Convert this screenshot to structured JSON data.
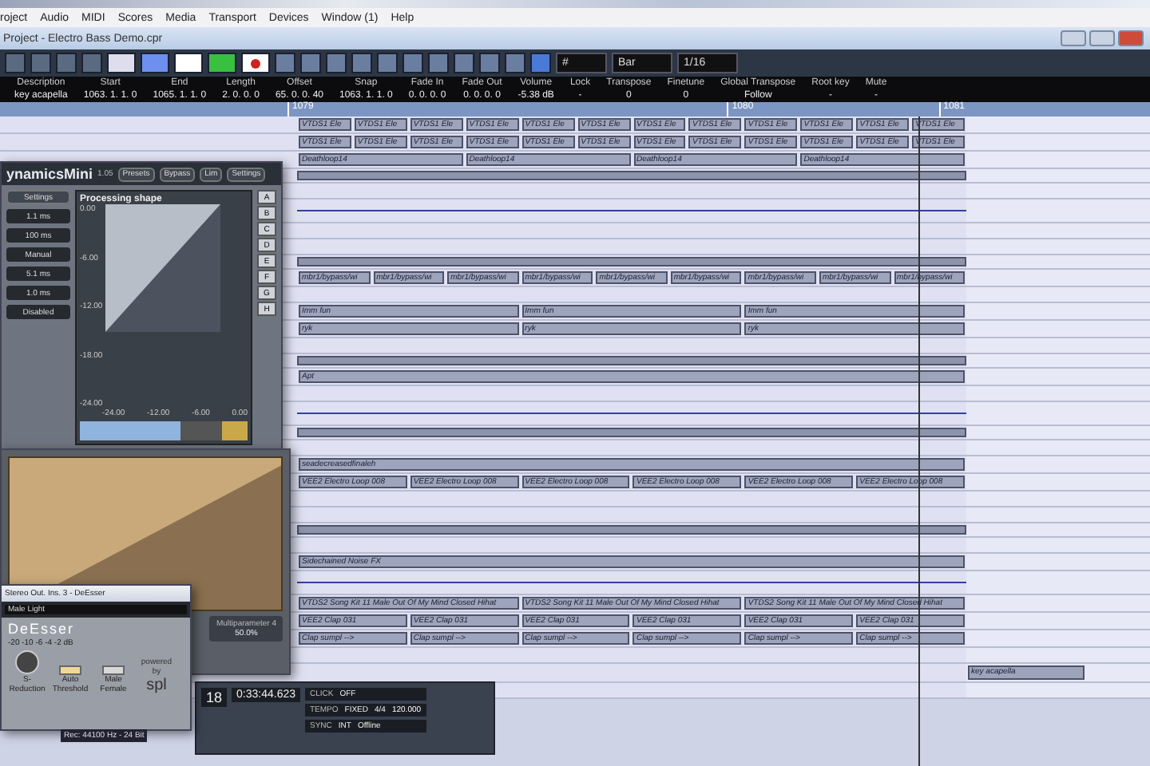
{
  "menu": [
    "roject",
    "Audio",
    "MIDI",
    "Scores",
    "Media",
    "Transport",
    "Devices",
    "Window (1)",
    "Help"
  ],
  "window": {
    "title": "Project - Electro Bass Demo.cpr"
  },
  "toolbar": {
    "quantize": "1/16",
    "grid": "Bar",
    "grid_type": "#",
    "snap_on": true
  },
  "info_line": [
    {
      "label": "Description",
      "value": "key acapella"
    },
    {
      "label": "Start",
      "value": "1063. 1. 1. 0"
    },
    {
      "label": "End",
      "value": "1065. 1. 1. 0"
    },
    {
      "label": "Length",
      "value": "2. 0. 0. 0"
    },
    {
      "label": "Offset",
      "value": "65. 0. 0. 40"
    },
    {
      "label": "Snap",
      "value": "1063. 1. 1. 0"
    },
    {
      "label": "Fade In",
      "value": "0. 0. 0. 0"
    },
    {
      "label": "Fade Out",
      "value": "0. 0. 0. 0"
    },
    {
      "label": "Volume",
      "value": "-5.38 dB"
    },
    {
      "label": "Lock",
      "value": "-"
    },
    {
      "label": "Transpose",
      "value": "0"
    },
    {
      "label": "Finetune",
      "value": "0"
    },
    {
      "label": "Global Transpose",
      "value": "Follow"
    },
    {
      "label": "Root key",
      "value": "-"
    },
    {
      "label": "Mute",
      "value": "-"
    }
  ],
  "ruler": [
    "1079",
    "1080",
    "1081"
  ],
  "lanes": [
    {
      "kind": "events",
      "events": [
        "VTDS1 Ele",
        "VTDS1 Ele",
        "VTDS1 Ele",
        "VTDS1 Ele",
        "VTDS1 Ele",
        "VTDS1 Ele",
        "VTDS1 Ele",
        "VTDS1 Ele",
        "VTDS1 Ele",
        "VTDS1 Ele",
        "VTDS1 Ele",
        "VTDS1 Ele"
      ]
    },
    {
      "kind": "events",
      "events": [
        "VTDS1 Ele",
        "VTDS1 Ele",
        "VTDS1 Ele",
        "VTDS1 Ele",
        "VTDS1 Ele",
        "VTDS1 Ele",
        "VTDS1 Ele",
        "VTDS1 Ele",
        "VTDS1 Ele",
        "VTDS1 Ele",
        "VTDS1 Ele",
        "VTDS1 Ele"
      ]
    },
    {
      "kind": "events",
      "events": [
        "Deathloop14",
        "Deathloop14",
        "Deathloop14",
        "Deathloop14"
      ]
    },
    {
      "kind": "bar"
    },
    {
      "kind": "blank"
    },
    {
      "kind": "automation"
    },
    {
      "kind": "blank"
    },
    {
      "kind": "blank"
    },
    {
      "kind": "bar"
    },
    {
      "kind": "events",
      "events": [
        "mbr1/bypass/wi",
        "mbr1/bypass/wi",
        "mbr1/bypass/wi",
        "mbr1/bypass/wi",
        "mbr1/bypass/wi",
        "mbr1/bypass/wi",
        "mbr1/bypass/wi",
        "mbr1/bypass/wi",
        "mbr1/bypass/wi"
      ]
    },
    {
      "kind": "blank"
    },
    {
      "kind": "events",
      "events": [
        "Imm fun",
        "Imm fun",
        "Imm fun"
      ]
    },
    {
      "kind": "events",
      "events": [
        "ryk",
        "ryk",
        "ryk"
      ]
    },
    {
      "kind": "blank"
    },
    {
      "kind": "bar"
    },
    {
      "kind": "events",
      "events": [
        "Apt"
      ]
    },
    {
      "kind": "blank"
    },
    {
      "kind": "automation"
    },
    {
      "kind": "bar"
    },
    {
      "kind": "blank"
    },
    {
      "kind": "events",
      "events": [
        "seadecreasedfinaleh"
      ]
    },
    {
      "kind": "events",
      "events": [
        "VEE2 Electro Loop 008",
        "VEE2 Electro Loop 008",
        "VEE2 Electro Loop 008",
        "VEE2 Electro Loop 008",
        "VEE2 Electro Loop 008",
        "VEE2 Electro Loop 008"
      ]
    },
    {
      "kind": "blank"
    },
    {
      "kind": "blank"
    },
    {
      "kind": "bar"
    },
    {
      "kind": "blank"
    },
    {
      "kind": "events",
      "events": [
        "Sidechained Noise FX"
      ]
    },
    {
      "kind": "automation"
    },
    {
      "kind": "events",
      "events": [
        "VTDS2 Song Kit 11 Male Out Of My Mind Closed Hihat",
        "VTDS2 Song Kit 11 Male Out Of My Mind Closed Hihat",
        "VTDS2 Song Kit 11 Male Out Of My Mind Closed Hihat"
      ]
    },
    {
      "kind": "events",
      "events": [
        "VEE2 Clap 031",
        "VEE2 Clap 031",
        "VEE2 Clap 031",
        "VEE2 Clap 031",
        "VEE2 Clap 031",
        "VEE2 Clap 031"
      ]
    },
    {
      "kind": "events",
      "events": [
        "Clap sumpl -->",
        "Clap sumpl -->",
        "Clap sumpl -->",
        "Clap sumpl -->",
        "Clap sumpl -->",
        "Clap sumpl -->"
      ]
    },
    {
      "kind": "blank"
    },
    {
      "kind": "tail",
      "events": [
        "key acapella"
      ]
    },
    {
      "kind": "blank"
    }
  ],
  "dynamics": {
    "title": "ynamicsMini",
    "version": "1.05",
    "buttons": [
      "Presets",
      "Bypass",
      "Lim",
      "Settings"
    ],
    "settings_label": "Settings",
    "params": [
      "1.1 ms",
      "100 ms",
      "Manual",
      "5.1 ms",
      "1.0 ms",
      "Disabled"
    ],
    "shape_title": "Processing shape",
    "y_ticks": [
      "0.00",
      "-6.00",
      "-12.00",
      "-18.00",
      "-24.00"
    ],
    "x_ticks": [
      "-24.00",
      "-12.00",
      "-6.00",
      "0.00"
    ],
    "side": [
      "A",
      "B",
      "C",
      "D",
      "E",
      "F",
      "G",
      "H"
    ]
  },
  "lower_panel": {
    "multiparam": "Multiparameter 4",
    "multiparam_value": "50.0%"
  },
  "deesser": {
    "title": "Stereo Out. Ins. 3 - DeEsser",
    "preset": "Male Light",
    "name": "DeEsser",
    "knob_label": "S-Reduction",
    "scale": "-20 -10 -6 -4 -2 dB",
    "auto_label": "Auto Threshold",
    "auto_on": true,
    "mf_label": "Male Female",
    "mf_on": false,
    "brand_small": "powered by",
    "brand": "spl"
  },
  "transport": {
    "bar": "18",
    "time": "0:33:44.623",
    "click": "CLICK",
    "click_value": "OFF",
    "tempo": "TEMPO",
    "tempo_mode": "FIXED",
    "signature": "4/4",
    "bpm": "120.000",
    "sync": "SYNC",
    "sync_value": "INT",
    "sync_state": "Offline"
  },
  "status": "Rec: 44100 Hz - 24 Bit"
}
